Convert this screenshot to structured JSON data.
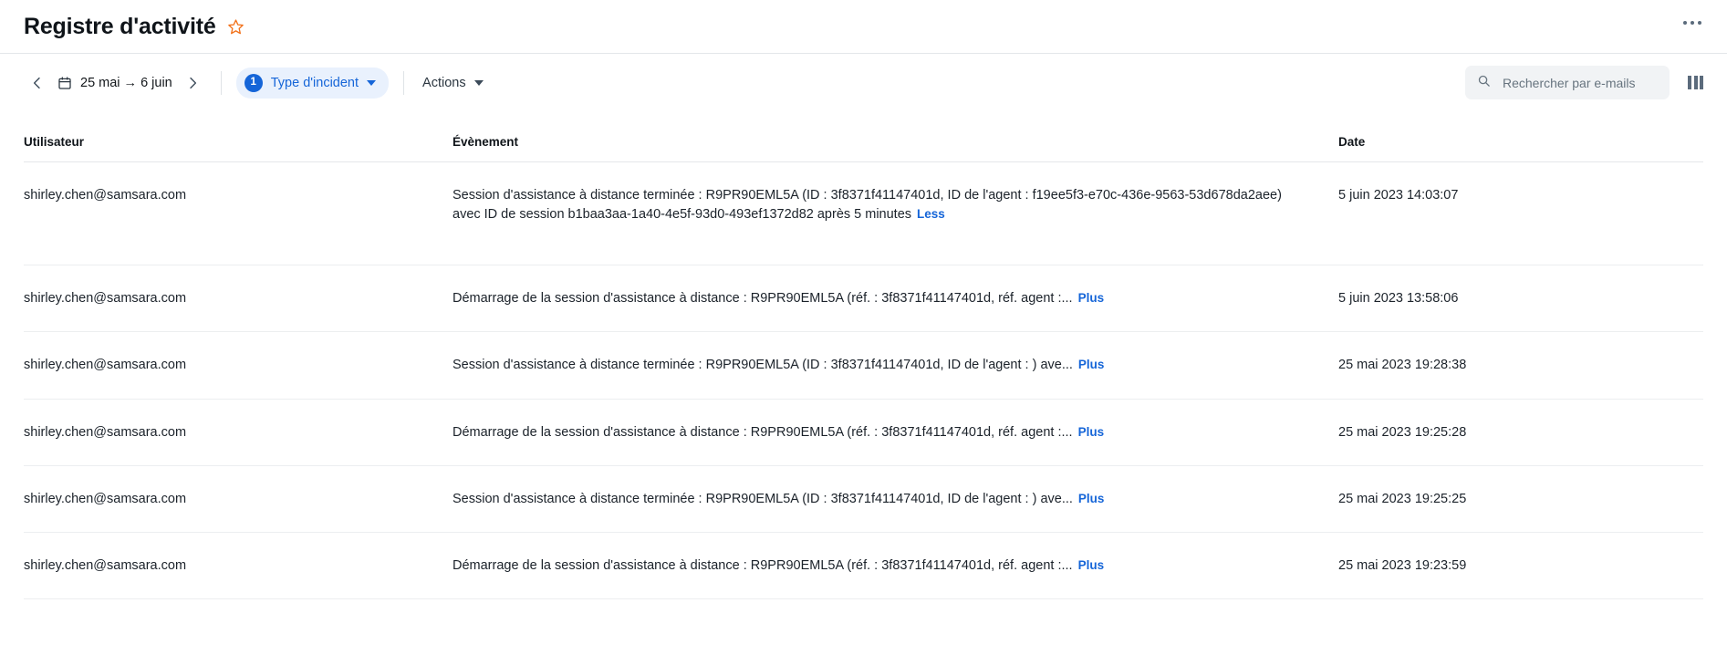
{
  "header": {
    "title": "Registre d'activité",
    "star_icon": "star-outline-icon",
    "overflow_icon": "more-horizontal-icon"
  },
  "toolbar": {
    "prev_label": "‹",
    "next_label": "›",
    "calendar_icon": "calendar-icon",
    "date_range": "25 mai → 6 juin",
    "filter": {
      "count": "1",
      "label": "Type d'incident",
      "caret_icon": "chevron-down-icon"
    },
    "actions": {
      "label": "Actions",
      "caret_icon": "chevron-down-icon"
    },
    "search": {
      "icon": "search-icon",
      "placeholder": "Rechercher par e-mails",
      "value": ""
    },
    "columns_icon": "columns-icon"
  },
  "table": {
    "columns": [
      "Utilisateur",
      "Évènement",
      "Date"
    ],
    "rows": [
      {
        "user": "shirley.chen@samsara.com",
        "event": "Session d'assistance à distance terminée : R9PR90EML5A (ID : 3f8371f41147401d, ID de l'agent : f19ee5f3-e70c-436e-9563-53d678da2aee) avec ID de session b1baa3aa-1a40-4e5f-93d0-493ef1372d82 après 5 minutes",
        "link": "Less",
        "date": "5 juin 2023 14:03:07"
      },
      {
        "user": "shirley.chen@samsara.com",
        "event": "Démarrage de la session d'assistance à distance : R9PR90EML5A (réf. : 3f8371f41147401d, réf. agent :...",
        "link": "Plus",
        "date": "5 juin 2023 13:58:06"
      },
      {
        "user": "shirley.chen@samsara.com",
        "event": "Session d'assistance à distance terminée : R9PR90EML5A (ID : 3f8371f41147401d, ID de l'agent : ) ave...",
        "link": "Plus",
        "date": "25 mai 2023 19:28:38"
      },
      {
        "user": "shirley.chen@samsara.com",
        "event": "Démarrage de la session d'assistance à distance : R9PR90EML5A (réf. : 3f8371f41147401d, réf. agent :...",
        "link": "Plus",
        "date": "25 mai 2023 19:25:28"
      },
      {
        "user": "shirley.chen@samsara.com",
        "event": "Session d'assistance à distance terminée : R9PR90EML5A (ID : 3f8371f41147401d, ID de l'agent : ) ave...",
        "link": "Plus",
        "date": "25 mai 2023 19:25:25"
      },
      {
        "user": "shirley.chen@samsara.com",
        "event": "Démarrage de la session d'assistance à distance : R9PR90EML5A (réf. : 3f8371f41147401d, réf. agent :...",
        "link": "Plus",
        "date": "25 mai 2023 19:23:59"
      }
    ]
  },
  "colors": {
    "accent_blue": "#1565d8",
    "chip_bg": "#e9f1fd",
    "star_orange": "#f2721c",
    "text_primary": "#12161a",
    "border": "#e4e7ea"
  }
}
